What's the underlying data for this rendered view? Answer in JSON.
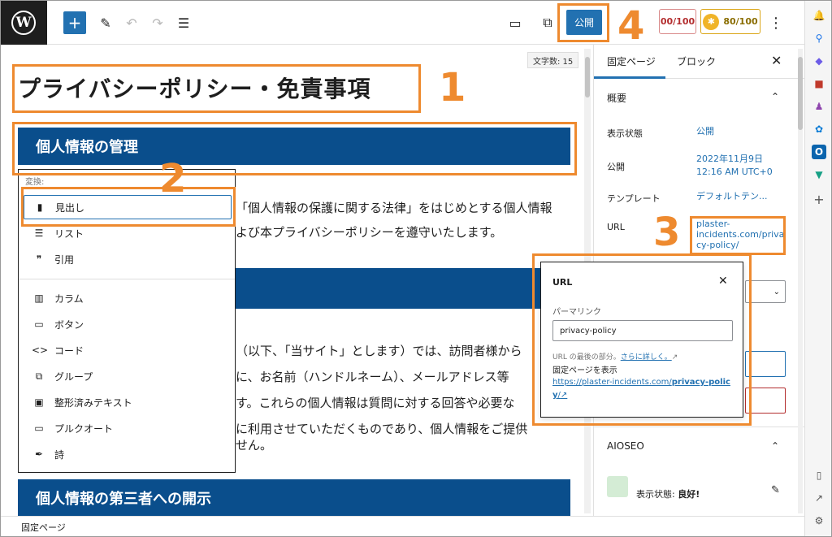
{
  "toolbar": {
    "add_label": "+",
    "pen_glyph": "✎",
    "undo_glyph": "↶",
    "redo_glyph": "↷",
    "list_glyph": "☰",
    "device_glyph": "▭",
    "external_glyph": "⧉",
    "publish_label": "公開",
    "score_seo": "00/100",
    "score_readability": "80/100",
    "more_glyph": "⋮"
  },
  "editor": {
    "word_count": "文字数: 15",
    "title": "プライバシーポリシー・免責事項",
    "heading1": "個人情報の管理",
    "para1": [
      "「個人情報の保護に関する法律」をはじめとする個人情報",
      "よび本プライバシーポリシーを遵守いたします。"
    ],
    "para2": [
      "（以下、「当サイト」とします）では、訪問者様から",
      "に、お名前（ハンドルネーム）、メールアドレス等",
      "す。これらの個人情報は質問に対する回答や必要な",
      "に利用させていただくものであり、個人情報をご提供",
      "せん。"
    ],
    "heading3": "個人情報の第三者への開示"
  },
  "transform_menu": {
    "label": "変換:",
    "items": [
      {
        "icon": "bookmark-icon",
        "glyph": "▮",
        "label": "見出し"
      },
      {
        "icon": "list-icon",
        "glyph": "☰",
        "label": "リスト"
      },
      {
        "icon": "quote-icon",
        "glyph": "❞",
        "label": "引用"
      },
      {
        "icon": "columns-icon",
        "glyph": "▥",
        "label": "カラム"
      },
      {
        "icon": "buttons-icon",
        "glyph": "▭",
        "label": "ボタン"
      },
      {
        "icon": "code-icon",
        "glyph": "<>",
        "label": "コード"
      },
      {
        "icon": "group-icon",
        "glyph": "⧉",
        "label": "グループ"
      },
      {
        "icon": "preformatted-icon",
        "glyph": "▣",
        "label": "整形済みテキスト"
      },
      {
        "icon": "pullquote-icon",
        "glyph": "▭",
        "label": "プルクオート"
      },
      {
        "icon": "verse-icon",
        "glyph": "✒",
        "label": "詩"
      }
    ]
  },
  "settings": {
    "tab_page": "固定ページ",
    "tab_block": "ブロック",
    "close_glyph": "✕",
    "summary_title": "概要",
    "chevron_up": "⌃",
    "visibility_label": "表示状態",
    "visibility_value": "公開",
    "publish_label": "公開",
    "publish_value_date": "2022年11月9日",
    "publish_value_time": "12:16 AM UTC+0",
    "template_label": "テンプレート",
    "template_value": "デフォルトテン...",
    "url_label": "URL",
    "url_value": [
      "plaster-",
      "incidents.com/priva",
      "cy-policy/"
    ],
    "select_chevron": "⌄",
    "aioseo_title": "AIOSEO",
    "aioseo_status_label": "表示状態:",
    "aioseo_status_value": "良好!",
    "pencil_glyph": "✎"
  },
  "url_popover": {
    "title": "URL",
    "close_glyph": "✕",
    "permalink_label": "パーマリンク",
    "permalink_value": "privacy-policy",
    "help_text": "URL の最後の部分。",
    "help_link": "さらに詳しく。",
    "view_label": "固定ページを表示",
    "link_prefix": "https://plaster-incidents.com/",
    "link_bold": "privacy-policy",
    "link_suffix": "/",
    "ext_glyph": "↗"
  },
  "statusbar": {
    "text": "固定ページ"
  },
  "annotations": {
    "n1": "1",
    "n2": "2",
    "n3": "3",
    "n4": "4",
    "color": "#ee8a2f"
  },
  "browser_side": {
    "icons": [
      {
        "name": "bell-icon",
        "glyph": "🔔",
        "color": "#1a73e8"
      },
      {
        "name": "search-icon",
        "glyph": "⚲",
        "color": "#1a73e8"
      },
      {
        "name": "tag-icon",
        "glyph": "◆",
        "color": "#6c5ce7"
      },
      {
        "name": "briefcase-icon",
        "glyph": "■",
        "color": "#c0392b"
      },
      {
        "name": "chess-icon",
        "glyph": "♟",
        "color": "#8e44ad"
      },
      {
        "name": "copilot-icon",
        "glyph": "✿",
        "color": "#0078d4"
      },
      {
        "name": "outlook-icon",
        "glyph": "O",
        "color": "#0a64ad"
      },
      {
        "name": "cart-icon",
        "glyph": "▼",
        "color": "#16a085"
      },
      {
        "name": "add-icon",
        "glyph": "+",
        "color": "#555"
      },
      {
        "name": "sidebar-icon",
        "glyph": "▯",
        "color": "#555"
      },
      {
        "name": "popout-icon",
        "glyph": "↗",
        "color": "#555"
      },
      {
        "name": "settings-icon",
        "glyph": "⚙",
        "color": "#555"
      }
    ]
  }
}
